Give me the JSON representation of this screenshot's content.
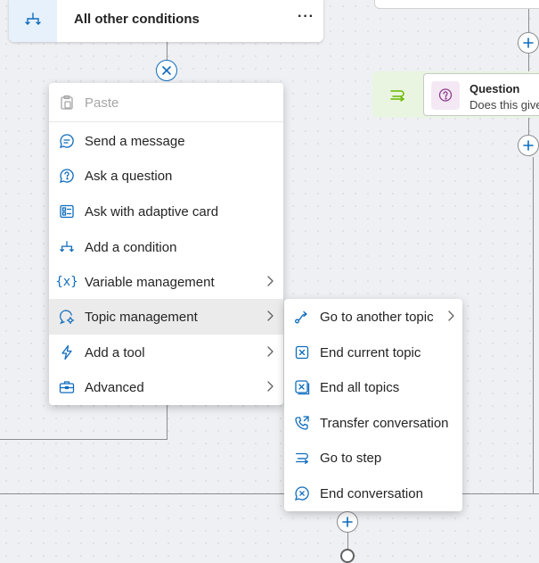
{
  "canvas": {
    "condition_card": {
      "title": "All other conditions",
      "more_label": "···"
    },
    "question_node": {
      "title": "Question",
      "subtitle": "Does this give"
    }
  },
  "context_menu": {
    "items": [
      {
        "label": "Paste",
        "icon": "clipboard-icon",
        "disabled": true
      },
      {
        "label": "Send a message",
        "icon": "chat-bubble-icon"
      },
      {
        "label": "Ask a question",
        "icon": "question-bubble-icon"
      },
      {
        "label": "Ask with adaptive card",
        "icon": "adaptive-card-icon"
      },
      {
        "label": "Add a condition",
        "icon": "branch-icon"
      },
      {
        "label": "Variable management",
        "icon": "variable-icon",
        "submenu": true
      },
      {
        "label": "Topic management",
        "icon": "topic-gear-icon",
        "submenu": true,
        "active": true
      },
      {
        "label": "Add a tool",
        "icon": "lightning-icon",
        "submenu": true
      },
      {
        "label": "Advanced",
        "icon": "toolbox-icon",
        "submenu": true
      }
    ]
  },
  "topic_submenu": {
    "items": [
      {
        "label": "Go to another topic",
        "icon": "redirect-icon",
        "submenu": true
      },
      {
        "label": "End current topic",
        "icon": "end-topic-icon"
      },
      {
        "label": "End all topics",
        "icon": "end-all-topics-icon"
      },
      {
        "label": "Transfer conversation",
        "icon": "transfer-phone-icon"
      },
      {
        "label": "Go to step",
        "icon": "go-to-step-icon"
      },
      {
        "label": "End conversation",
        "icon": "end-conversation-icon"
      }
    ]
  },
  "colors": {
    "accent": "#0f6cbd",
    "icon": "#0f6cbd",
    "question_green": "#e9f5e0",
    "question_purple": "#8a3d8a",
    "menu_active": "#ebebeb"
  }
}
